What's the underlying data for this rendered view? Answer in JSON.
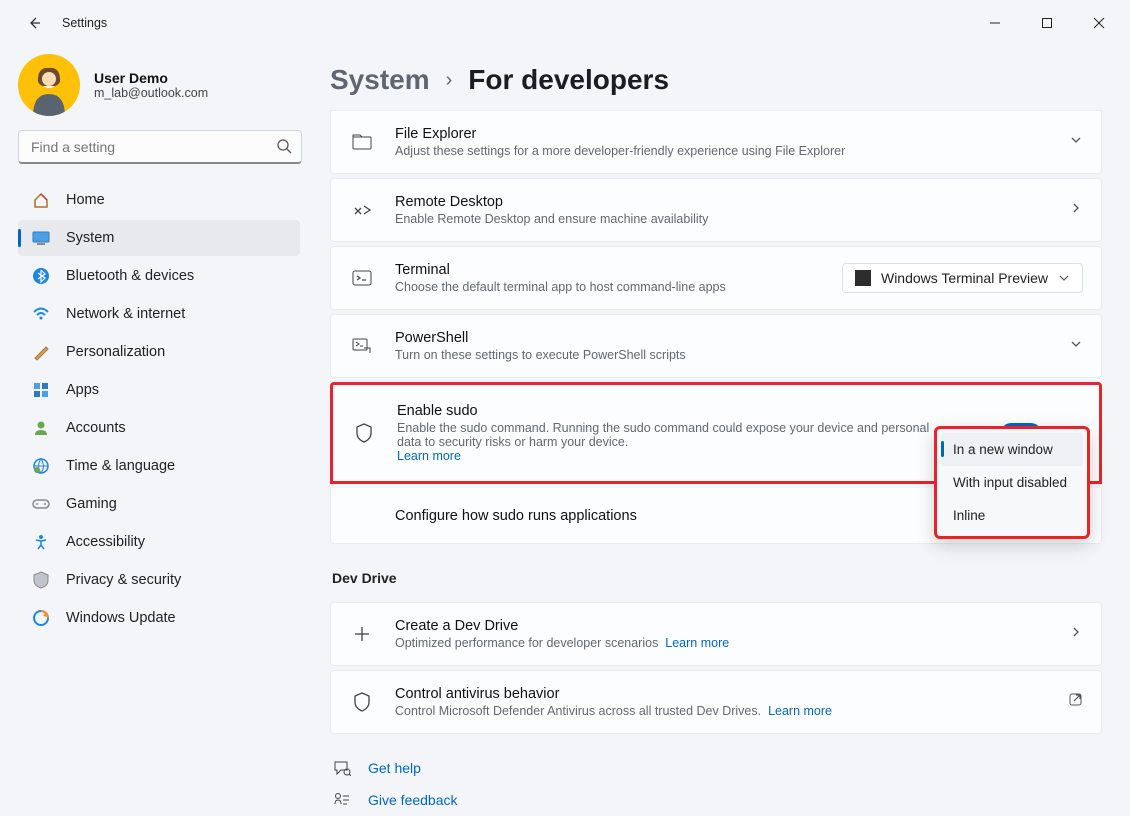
{
  "window": {
    "title": "Settings"
  },
  "profile": {
    "name": "User Demo",
    "email": "m_lab@outlook.com"
  },
  "search": {
    "placeholder": "Find a setting"
  },
  "sidebar": {
    "items": [
      {
        "label": "Home"
      },
      {
        "label": "System"
      },
      {
        "label": "Bluetooth & devices"
      },
      {
        "label": "Network & internet"
      },
      {
        "label": "Personalization"
      },
      {
        "label": "Apps"
      },
      {
        "label": "Accounts"
      },
      {
        "label": "Time & language"
      },
      {
        "label": "Gaming"
      },
      {
        "label": "Accessibility"
      },
      {
        "label": "Privacy & security"
      },
      {
        "label": "Windows Update"
      }
    ]
  },
  "breadcrumb": {
    "parent": "System",
    "current": "For developers"
  },
  "cards": {
    "file_explorer": {
      "title": "File Explorer",
      "desc": "Adjust these settings for a more developer-friendly experience using File Explorer"
    },
    "remote_desktop": {
      "title": "Remote Desktop",
      "desc": "Enable Remote Desktop and ensure machine availability"
    },
    "terminal": {
      "title": "Terminal",
      "desc": "Choose the default terminal app to host command-line apps",
      "selected": "Windows Terminal Preview"
    },
    "powershell": {
      "title": "PowerShell",
      "desc": "Turn on these settings to execute PowerShell scripts"
    },
    "sudo": {
      "title": "Enable sudo",
      "desc": "Enable the sudo command. Running the sudo command could expose your device and personal data to security risks or harm your device.",
      "learn_more": "Learn more",
      "state": "On"
    },
    "configure_sudo": {
      "title": "Configure how sudo runs applications"
    },
    "dev_drive_create": {
      "title": "Create a Dev Drive",
      "desc": "Optimized performance for developer scenarios",
      "learn_more": "Learn more"
    },
    "antivirus": {
      "title": "Control antivirus behavior",
      "desc": "Control Microsoft Defender Antivirus across all trusted Dev Drives.",
      "learn_more": "Learn more"
    }
  },
  "section": {
    "dev_drive": "Dev Drive"
  },
  "sudo_dropdown": {
    "options": [
      {
        "label": "In a new window"
      },
      {
        "label": "With input disabled"
      },
      {
        "label": "Inline"
      }
    ]
  },
  "help": {
    "get_help": "Get help",
    "feedback": "Give feedback"
  }
}
